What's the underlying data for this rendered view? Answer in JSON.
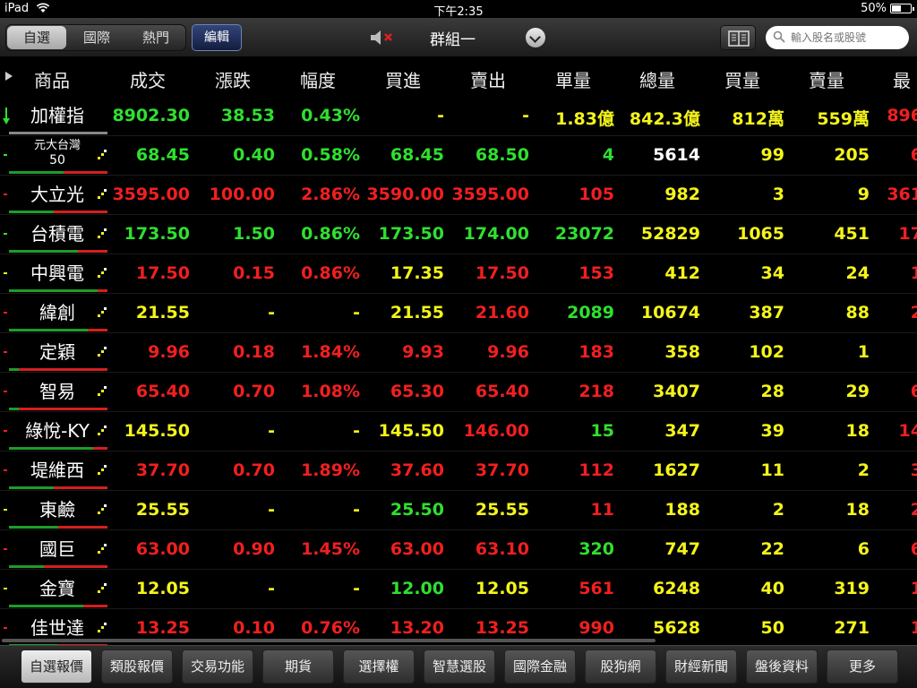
{
  "status": {
    "device": "iPad",
    "time": "下午2:35",
    "battery": "50%",
    "battery_level": 0.5
  },
  "toolbar": {
    "segments": [
      "自選",
      "國際",
      "熱門"
    ],
    "edit_label": "編輯",
    "group_label": "群組一",
    "search_placeholder": "輸入股名或股號"
  },
  "columns": [
    "商品",
    "成交",
    "漲跌",
    "幅度",
    "買進",
    "賣出",
    "單量",
    "總量",
    "買量",
    "賣量",
    "最"
  ],
  "rows": [
    {
      "name": "加權指",
      "name2": "",
      "cells": [
        "8902.30",
        "38.53",
        "0.43%",
        "-",
        "-",
        "1.83億",
        "842.3億",
        "812萬",
        "559萬",
        "896"
      ],
      "colors": [
        "gr",
        "gr",
        "gr",
        "y",
        "y",
        "y",
        "y",
        "y",
        "y",
        "rd"
      ],
      "ind": "down",
      "g": 0,
      "r": 0
    },
    {
      "name": "元大台灣",
      "name2": "50",
      "cells": [
        "68.45",
        "0.40",
        "0.58%",
        "68.45",
        "68.50",
        "4",
        "5614",
        "99",
        "205",
        "6"
      ],
      "colors": [
        "gr",
        "gr",
        "gr",
        "gr",
        "gr",
        "gr",
        "wh",
        "y",
        "y",
        "rd"
      ],
      "ind": "g",
      "g": 0.55,
      "r": 0.45
    },
    {
      "name": "大立光",
      "name2": "",
      "cells": [
        "3595.00",
        "100.00",
        "2.86%",
        "3590.00",
        "3595.00",
        "105",
        "982",
        "3",
        "9",
        "361"
      ],
      "colors": [
        "rd",
        "rd",
        "rd",
        "rd",
        "rd",
        "rd",
        "y",
        "y",
        "y",
        "rd"
      ],
      "ind": "r",
      "g": 0.45,
      "r": 0.55
    },
    {
      "name": "台積電",
      "name2": "",
      "cells": [
        "173.50",
        "1.50",
        "0.86%",
        "173.50",
        "174.00",
        "23072",
        "52829",
        "1065",
        "451",
        "17"
      ],
      "colors": [
        "gr",
        "gr",
        "gr",
        "gr",
        "gr",
        "gr",
        "y",
        "y",
        "y",
        "rd"
      ],
      "ind": "g",
      "g": 0.7,
      "r": 0.3
    },
    {
      "name": "中興電",
      "name2": "",
      "cells": [
        "17.50",
        "0.15",
        "0.86%",
        "17.35",
        "17.50",
        "153",
        "412",
        "34",
        "24",
        "1"
      ],
      "colors": [
        "rd",
        "rd",
        "rd",
        "y",
        "rd",
        "rd",
        "y",
        "y",
        "y",
        "rd"
      ],
      "ind": "y",
      "g": 0.9,
      "r": 0.1
    },
    {
      "name": "緯創",
      "name2": "",
      "cells": [
        "21.55",
        "-",
        "-",
        "21.55",
        "21.60",
        "2089",
        "10674",
        "387",
        "88",
        "2"
      ],
      "colors": [
        "y",
        "y",
        "y",
        "y",
        "rd",
        "gr",
        "y",
        "y",
        "y",
        "rd"
      ],
      "ind": "r",
      "g": 0.8,
      "r": 0.2
    },
    {
      "name": "定穎",
      "name2": "",
      "cells": [
        "9.96",
        "0.18",
        "1.84%",
        "9.93",
        "9.96",
        "183",
        "358",
        "102",
        "1",
        ""
      ],
      "colors": [
        "rd",
        "rd",
        "rd",
        "rd",
        "rd",
        "rd",
        "y",
        "y",
        "y",
        "rd"
      ],
      "ind": "r",
      "g": 0.1,
      "r": 0.9
    },
    {
      "name": "智易",
      "name2": "",
      "cells": [
        "65.40",
        "0.70",
        "1.08%",
        "65.30",
        "65.40",
        "218",
        "3407",
        "28",
        "29",
        "6"
      ],
      "colors": [
        "rd",
        "rd",
        "rd",
        "rd",
        "rd",
        "rd",
        "y",
        "y",
        "y",
        "rd"
      ],
      "ind": "r",
      "g": 0.1,
      "r": 0.9
    },
    {
      "name": "綠悅-KY",
      "name2": "",
      "cells": [
        "145.50",
        "-",
        "-",
        "145.50",
        "146.00",
        "15",
        "347",
        "39",
        "18",
        "14"
      ],
      "colors": [
        "y",
        "y",
        "y",
        "y",
        "rd",
        "gr",
        "y",
        "y",
        "y",
        "rd"
      ],
      "ind": "r",
      "g": 0.85,
      "r": 0.15
    },
    {
      "name": "堤維西",
      "name2": "",
      "cells": [
        "37.70",
        "0.70",
        "1.89%",
        "37.60",
        "37.70",
        "112",
        "1627",
        "11",
        "2",
        "3"
      ],
      "colors": [
        "rd",
        "rd",
        "rd",
        "rd",
        "rd",
        "rd",
        "y",
        "y",
        "y",
        "rd"
      ],
      "ind": "r",
      "g": 0.45,
      "r": 0.55
    },
    {
      "name": "東鹼",
      "name2": "",
      "cells": [
        "25.55",
        "-",
        "-",
        "25.50",
        "25.55",
        "11",
        "188",
        "2",
        "18",
        "2"
      ],
      "colors": [
        "y",
        "y",
        "y",
        "gr",
        "y",
        "rd",
        "y",
        "y",
        "y",
        "rd"
      ],
      "ind": "y",
      "g": 0.5,
      "r": 0.5
    },
    {
      "name": "國巨",
      "name2": "",
      "cells": [
        "63.00",
        "0.90",
        "1.45%",
        "63.00",
        "63.10",
        "320",
        "747",
        "22",
        "6",
        "6"
      ],
      "colors": [
        "rd",
        "rd",
        "rd",
        "rd",
        "rd",
        "gr",
        "y",
        "y",
        "y",
        "rd"
      ],
      "ind": "r",
      "g": 0.35,
      "r": 0.65
    },
    {
      "name": "金寶",
      "name2": "",
      "cells": [
        "12.05",
        "-",
        "-",
        "12.00",
        "12.05",
        "561",
        "6248",
        "40",
        "319",
        "1"
      ],
      "colors": [
        "y",
        "y",
        "y",
        "gr",
        "y",
        "rd",
        "y",
        "y",
        "y",
        "rd"
      ],
      "ind": "y",
      "g": 0.75,
      "r": 0.25
    },
    {
      "name": "佳世達",
      "name2": "",
      "cells": [
        "13.25",
        "0.10",
        "0.76%",
        "13.20",
        "13.25",
        "990",
        "5628",
        "50",
        "271",
        "1"
      ],
      "colors": [
        "rd",
        "rd",
        "rd",
        "rd",
        "rd",
        "rd",
        "y",
        "y",
        "y",
        "rd"
      ],
      "ind": "r",
      "g": 0.5,
      "r": 0.5
    }
  ],
  "tabs": [
    "自選報價",
    "類股報價",
    "交易功能",
    "期貨",
    "選擇權",
    "智慧選股",
    "國際金融",
    "股狗網",
    "財經新聞",
    "盤後資料",
    "更多"
  ]
}
